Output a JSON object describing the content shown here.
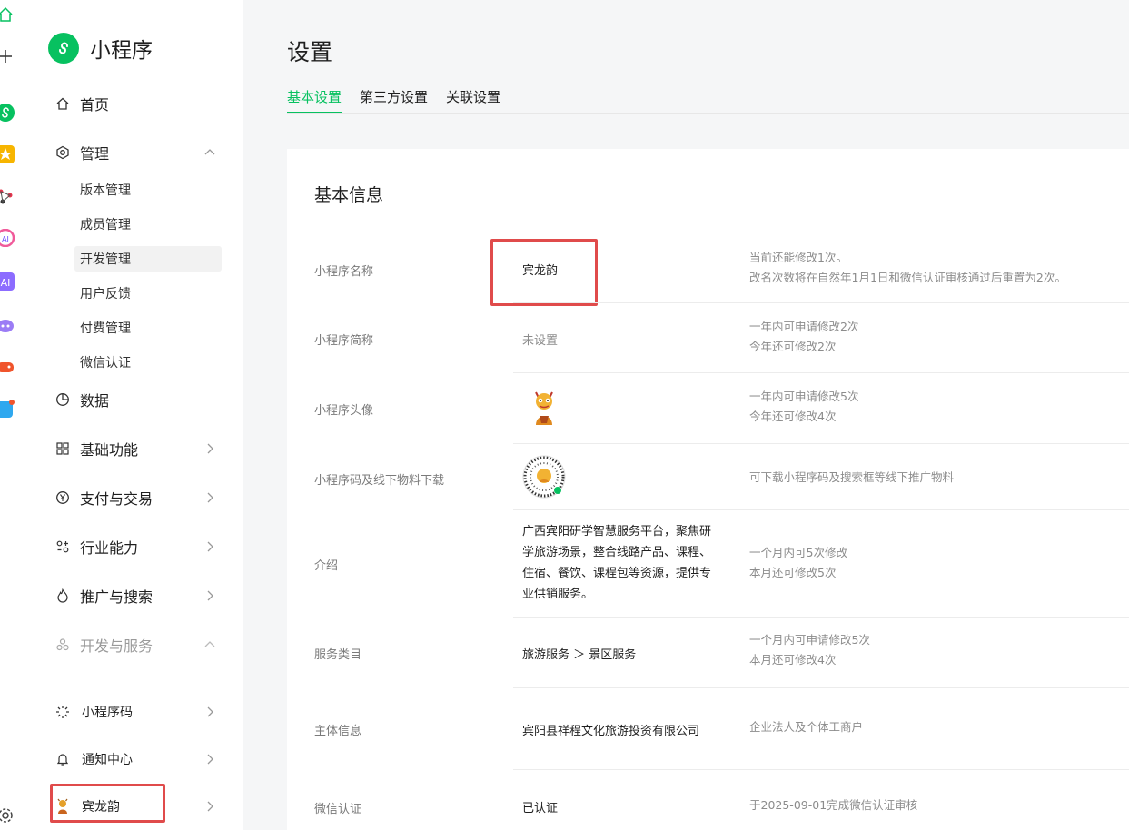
{
  "app": {
    "brand": "小程序"
  },
  "sidebar": {
    "home": "首页",
    "manage": "管理",
    "manage_sub": [
      "版本管理",
      "成员管理",
      "开发管理",
      "用户反馈",
      "付费管理",
      "微信认证"
    ],
    "data": "数据",
    "basic": "基础功能",
    "pay": "支付与交易",
    "industry": "行业能力",
    "promote": "推广与搜索",
    "devservice": "开发与服务",
    "qrcode": "小程序码",
    "notify": "通知中心",
    "account": "宾龙韵"
  },
  "page": {
    "title": "设置",
    "tabs": [
      "基本设置",
      "第三方设置",
      "关联设置"
    ]
  },
  "card": {
    "title": "基本信息",
    "rows": {
      "name": {
        "label": "小程序名称",
        "value": "宾龙韵",
        "note1": "当前还能修改1次。",
        "note2": "改名次数将在自然年1月1日和微信认证审核通过后重置为2次。"
      },
      "short": {
        "label": "小程序简称",
        "value": "未设置",
        "note1": "一年内可申请修改2次",
        "note2": "今年还可修改2次"
      },
      "avatar": {
        "label": "小程序头像",
        "note1": "一年内可申请修改5次",
        "note2": "今年还可修改4次"
      },
      "code": {
        "label": "小程序码及线下物料下载",
        "note1": "可下载小程序码及搜索框等线下推广物料"
      },
      "intro": {
        "label": "介绍",
        "lines": [
          "广西宾阳研学智慧服务平台，聚焦研",
          "学旅游场景，整合线路产品、课程、",
          "住宿、餐饮、课程包等资源，提供专",
          "业供销服务。"
        ],
        "note1": "一个月内可5次修改",
        "note2": "本月还可修改5次"
      },
      "category": {
        "label": "服务类目",
        "value": "旅游服务 ＞ 景区服务",
        "note1": "一个月内可申请修改5次",
        "note2": "本月还可修改4次"
      },
      "subject": {
        "label": "主体信息",
        "value": "宾阳县祥程文化旅游投资有限公司",
        "note1": "企业法人及个体工商户"
      },
      "verify": {
        "label": "微信认证",
        "value": "已认证",
        "note1": "于2025-09-01完成微信认证审核"
      }
    }
  },
  "colors": {
    "accent": "#07c160",
    "highlight": "#e04b4b"
  }
}
